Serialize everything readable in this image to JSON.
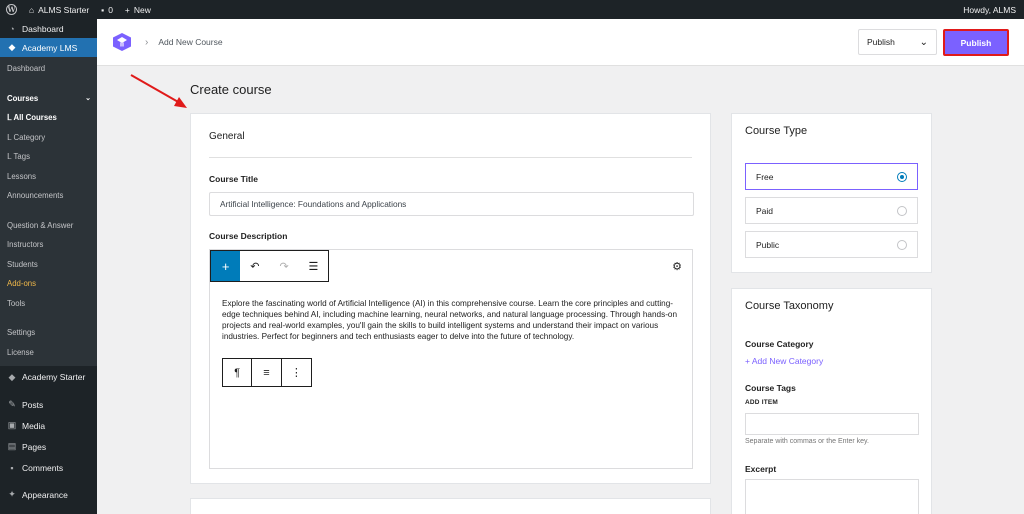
{
  "adminbar": {
    "site_name": "ALMS Starter",
    "comments_count": "0",
    "new_label": "New",
    "howdy": "Howdy, ALMS"
  },
  "sidebar": {
    "dashboard": "Dashboard",
    "academy_lms": "Academy LMS",
    "sub": {
      "dashboard": "Dashboard",
      "courses": "Courses",
      "all_courses": "ᒪ All Courses",
      "category": "ᒪ Category",
      "tags": "ᒪ Tags",
      "lessons": "Lessons",
      "announcements": "Announcements",
      "qa": "Question & Answer",
      "instructors": "Instructors",
      "students": "Students",
      "addons": "Add-ons",
      "tools": "Tools",
      "settings": "Settings",
      "license": "License"
    },
    "academy_starter": "Academy Starter",
    "posts": "Posts",
    "media": "Media",
    "pages": "Pages",
    "comments": "Comments",
    "appearance": "Appearance"
  },
  "header": {
    "breadcrumb": "Add New Course",
    "publish_select": "Publish",
    "publish_button": "Publish"
  },
  "page": {
    "title": "Create course"
  },
  "general": {
    "heading": "General",
    "course_title_label": "Course Title",
    "course_title_value": "Artificial Intelligence: Foundations and Applications",
    "course_description_label": "Course Description",
    "description": "Explore the fascinating world of Artificial Intelligence (AI) in this comprehensive course. Learn the core principles and cutting-edge techniques behind AI, including machine learning, neural networks, and natural language processing. Through hands-on projects and real-world examples, you'll gain the skills to build intelligent systems and understand their impact on various industries. Perfect for beginners and tech enthusiasts eager to delve into the future of technology."
  },
  "course_type": {
    "heading": "Course Type",
    "options": [
      "Free",
      "Paid",
      "Public"
    ],
    "selected": "Free"
  },
  "taxonomy": {
    "heading": "Course Taxonomy",
    "category_label": "Course Category",
    "add_category": "+ Add New Category",
    "tags_label": "Course Tags",
    "add_item": "ADD ITEM",
    "help": "Separate with commas or the Enter key.",
    "excerpt_label": "Excerpt"
  },
  "colors": {
    "accent": "#7b61ff",
    "wp_blue": "#2271b1",
    "highlight": "#e01a1a"
  }
}
